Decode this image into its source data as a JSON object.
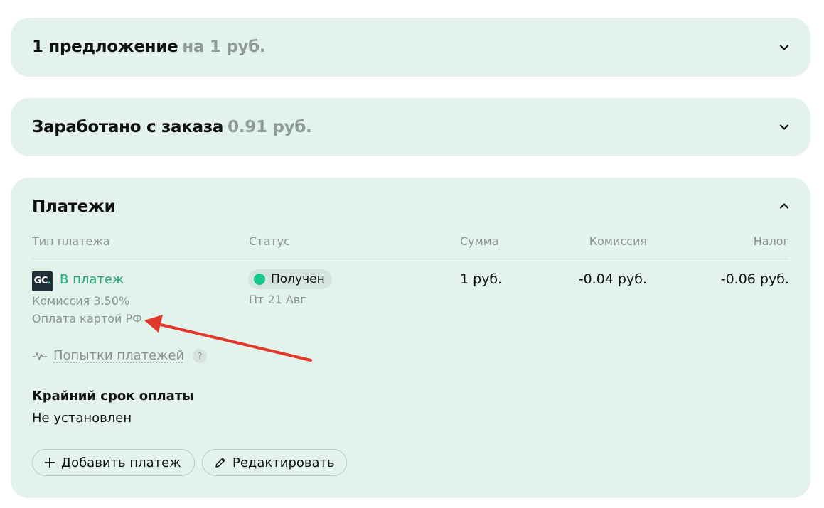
{
  "offers": {
    "title": "1 предложение",
    "amount": "на 1 руб."
  },
  "earned": {
    "title": "Заработано с заказа",
    "amount": "0.91 руб."
  },
  "payments": {
    "title": "Платежи",
    "headers": {
      "type": "Тип платежа",
      "status": "Статус",
      "sum": "Сумма",
      "commission": "Комиссия",
      "tax": "Налог"
    },
    "row": {
      "logo": "GC",
      "type_link": "В платеж",
      "commission_note": "Комиссия 3.50%",
      "method": "Оплата картой РФ",
      "status": "Получен",
      "status_color": "#14c98a",
      "date": "Пт 21 Авг",
      "sum": "1 руб.",
      "commission": "-0.04 руб.",
      "tax": "-0.06 руб."
    },
    "attempts_label": "Попытки платежей",
    "help_badge": "?",
    "deadline_title": "Крайний срок оплаты",
    "deadline_value": "Не установлен",
    "add_button": "Добавить платеж",
    "edit_button": "Редактировать"
  },
  "colors": {
    "card_bg": "#e3f3ec",
    "link_green": "#1fa876",
    "annotation_arrow": "#e0392b"
  },
  "icons": {
    "chevron_down": "chevron-down-icon",
    "chevron_up": "chevron-up-icon",
    "plus": "plus-icon",
    "pencil": "pencil-icon",
    "attempts": "pulse-icon"
  }
}
